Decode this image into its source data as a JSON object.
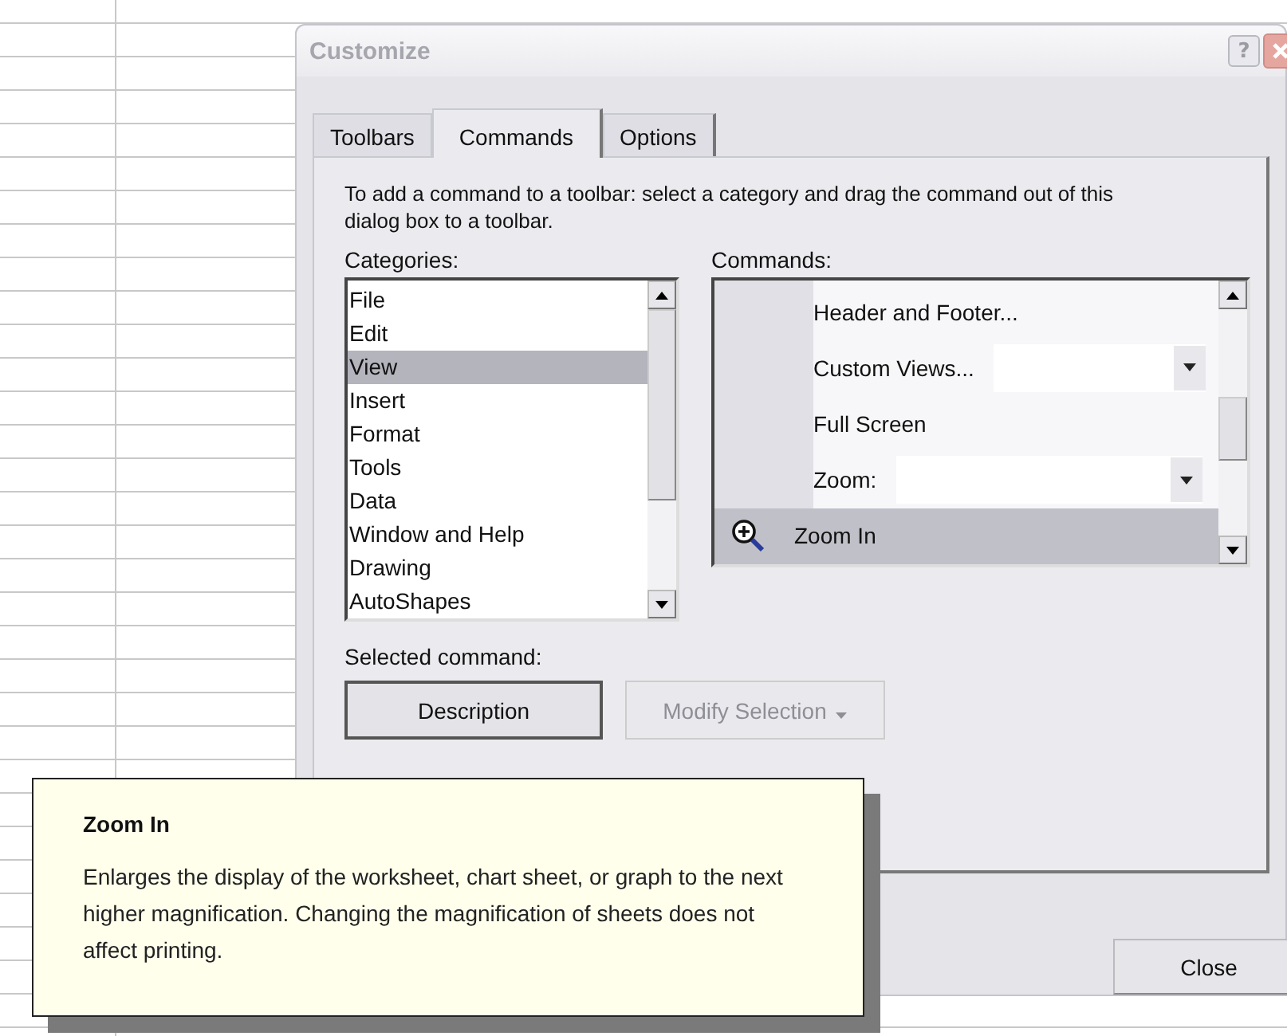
{
  "dialog": {
    "title": "Customize",
    "help_button": "?",
    "tabs": [
      {
        "label": "Toolbars",
        "selected": false
      },
      {
        "label": "Commands",
        "selected": true
      },
      {
        "label": "Options",
        "selected": false
      }
    ],
    "instructions": "To add a command to a toolbar: select a category and drag the command out of this dialog box to a toolbar.",
    "categories": {
      "label": "Categories:",
      "items": [
        {
          "label": "File",
          "selected": false
        },
        {
          "label": "Edit",
          "selected": false
        },
        {
          "label": "View",
          "selected": true
        },
        {
          "label": "Insert",
          "selected": false
        },
        {
          "label": "Format",
          "selected": false
        },
        {
          "label": "Tools",
          "selected": false
        },
        {
          "label": "Data",
          "selected": false
        },
        {
          "label": "Window and Help",
          "selected": false
        },
        {
          "label": "Drawing",
          "selected": false
        },
        {
          "label": "AutoShapes",
          "selected": false
        }
      ]
    },
    "commands": {
      "label": "Commands:",
      "items": [
        {
          "kind": "plain",
          "label": "Header and Footer...",
          "selected": false
        },
        {
          "kind": "combo",
          "label": "Custom Views...",
          "selected": false
        },
        {
          "kind": "plain",
          "label": "Full Screen",
          "selected": false
        },
        {
          "kind": "combo",
          "label": "Zoom:",
          "selected": false
        },
        {
          "kind": "zoom",
          "label": "Zoom In",
          "selected": true
        }
      ]
    },
    "selected_command": {
      "label": "Selected command:",
      "buttons": [
        {
          "kind": "button",
          "label": "Description",
          "disabled": false
        },
        {
          "kind": "menu",
          "label": "Modify Selection",
          "disabled": true
        }
      ]
    },
    "close_button": "Close"
  },
  "tooltip": {
    "title": "Zoom In",
    "text": "Enlarges the display of the worksheet, chart sheet, or graph to the next higher magnification. Changing the magnification of sheets does not affect printing."
  }
}
